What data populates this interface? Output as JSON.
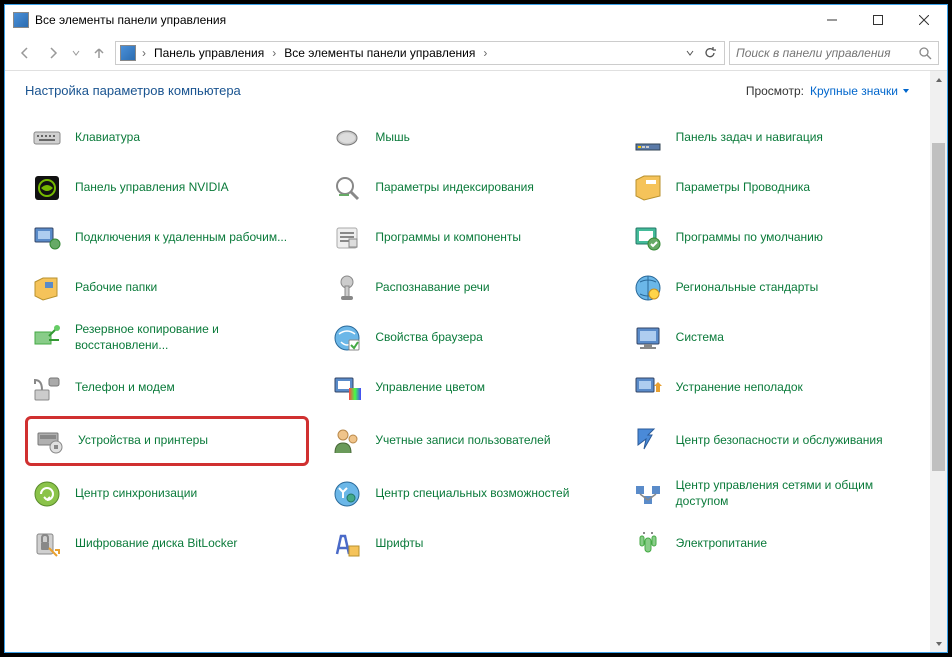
{
  "window": {
    "title": "Все элементы панели управления"
  },
  "breadcrumb": {
    "b1": "Панель управления",
    "b2": "Все элементы панели управления"
  },
  "search": {
    "placeholder": "Поиск в панели управления"
  },
  "header": {
    "title": "Настройка параметров компьютера",
    "viewby_label": "Просмотр:",
    "viewby_value": "Крупные значки"
  },
  "items": [
    {
      "label": "Клавиатура"
    },
    {
      "label": "Мышь"
    },
    {
      "label": "Панель задач и навигация"
    },
    {
      "label": "Панель управления NVIDIA"
    },
    {
      "label": "Параметры индексирования"
    },
    {
      "label": "Параметры Проводника"
    },
    {
      "label": "Подключения к удаленным рабочим..."
    },
    {
      "label": "Программы и компоненты"
    },
    {
      "label": "Программы по умолчанию"
    },
    {
      "label": "Рабочие папки"
    },
    {
      "label": "Распознавание речи"
    },
    {
      "label": "Региональные стандарты"
    },
    {
      "label": "Резервное копирование и восстановлени..."
    },
    {
      "label": "Свойства браузера"
    },
    {
      "label": "Система"
    },
    {
      "label": "Телефон и модем"
    },
    {
      "label": "Управление цветом"
    },
    {
      "label": "Устранение неполадок"
    },
    {
      "label": "Устройства и принтеры"
    },
    {
      "label": "Учетные записи пользователей"
    },
    {
      "label": "Центр безопасности и обслуживания"
    },
    {
      "label": "Центр синхронизации"
    },
    {
      "label": "Центр специальных возможностей"
    },
    {
      "label": "Центр управления сетями и общим доступом"
    },
    {
      "label": "Шифрование диска BitLocker"
    },
    {
      "label": "Шрифты"
    },
    {
      "label": "Электропитание"
    }
  ],
  "highlighted_index": 18
}
